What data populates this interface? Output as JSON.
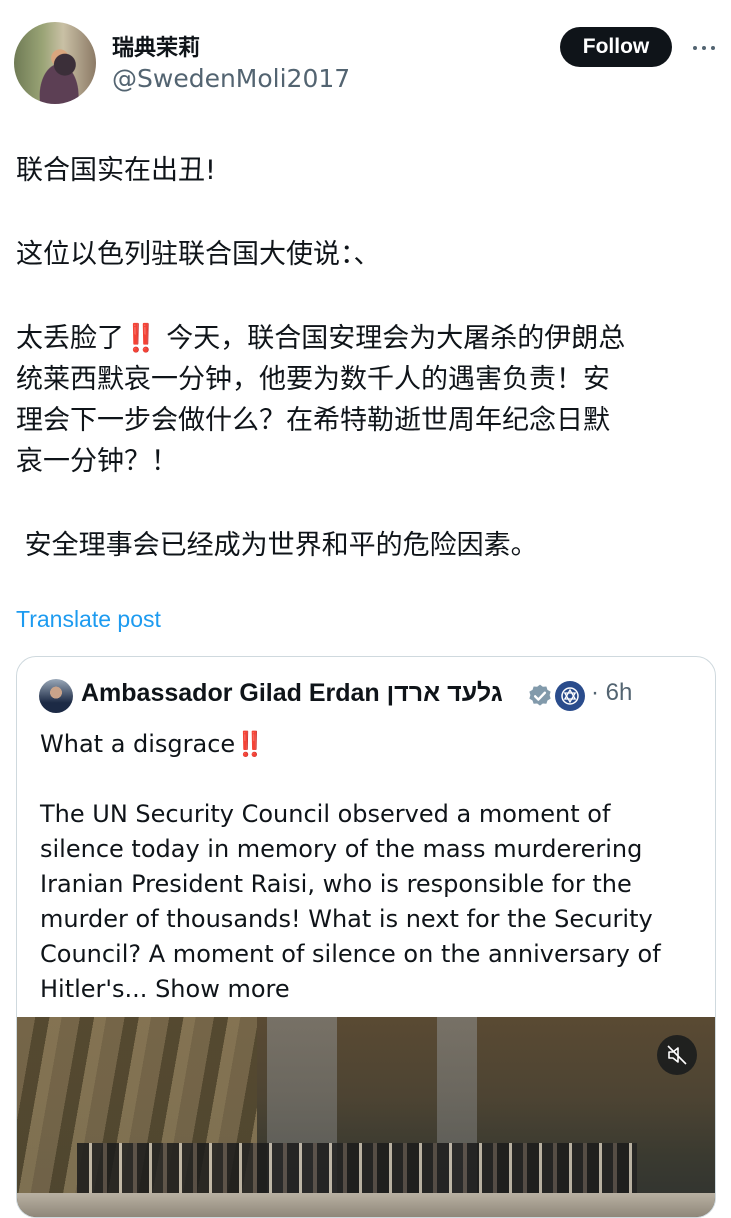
{
  "author": {
    "display_name": "瑞典茉莉",
    "handle": "@SwedenMoli2017",
    "follow_label": "Follow"
  },
  "post": {
    "line1": "联合国实在出丑!",
    "line2": "这位以色列驻联合国大使说：、",
    "para3_line1": "太丢脸了‼️ 今天，联合国安理会为大屠杀的伊朗总",
    "para3_line2": "统莱西默哀一分钟，他要为数千人的遇害负责！安",
    "para3_line3": "理会下一步会做什么？在希特勒逝世周年纪念日默",
    "para3_line4": "哀一分钟？！",
    "line5": " 安全理事会已经成为世界和平的危险因素。"
  },
  "translate_label": "Translate post",
  "quote": {
    "name": "Ambassador Gilad Erdan גלעד ארדן",
    "time": "· 6h",
    "line1": "What a disgrace‼️",
    "body_line1": "The UN Security Council observed a moment of",
    "body_line2": "silence today in memory of the mass murderering",
    "body_line3": "Iranian President Raisi, who is responsible for the",
    "body_line4": "murder of thousands! What is next for the Security",
    "body_line5": "Council? A moment of silence on the anniversary of",
    "body_line6": "Hitler's...",
    "show_more": "Show more"
  },
  "icons": {
    "more": "more-icon",
    "verified": "verified-badge-icon",
    "flag": "israel-un-mission-icon",
    "muted": "video-muted-icon"
  },
  "colors": {
    "link": "#1d9bf0",
    "text": "#0f1419",
    "secondary": "#536471",
    "border": "#cfd9de"
  }
}
